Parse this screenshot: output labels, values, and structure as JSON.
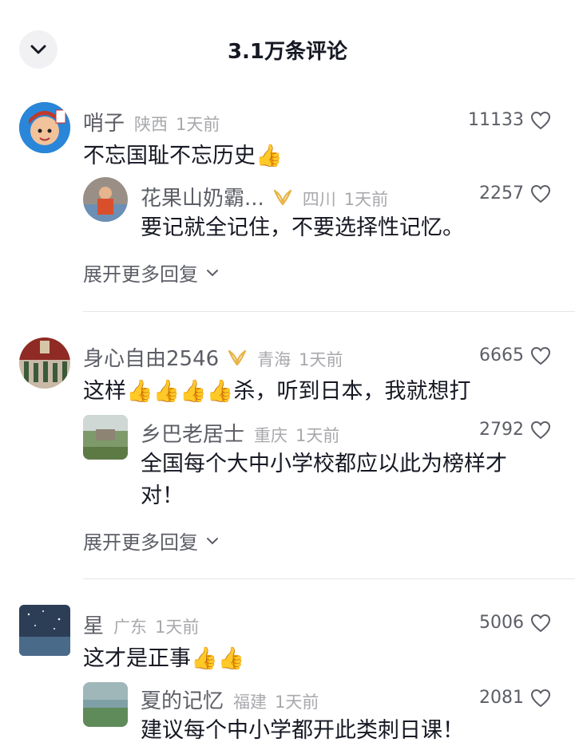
{
  "header": {
    "title": "3.1万条评论"
  },
  "comments": [
    {
      "user": "哨子",
      "region": "陕西",
      "time": "1天前",
      "likes": "11133",
      "text": "不忘国耻不忘历史👍",
      "reply": {
        "user": "花果山奶霸...",
        "region": "四川",
        "time": "1天前",
        "likes": "2257",
        "text": "要记就全记住，不要选择性记忆。"
      },
      "expand": "展开更多回复"
    },
    {
      "user": "身心自由2546",
      "region": "青海",
      "time": "1天前",
      "likes": "6665",
      "text": "这样👍👍👍👍杀，听到日本，我就想打",
      "reply": {
        "user": "乡巴老居士",
        "region": "重庆",
        "time": "1天前",
        "likes": "2792",
        "text_line1": "全国每个大中小学校都应以此为榜样才",
        "text_line2": "对！"
      },
      "expand": "展开更多回复"
    },
    {
      "user": "星",
      "region": "广东",
      "time": "1天前",
      "likes": "5006",
      "text": "这才是正事👍👍",
      "reply": {
        "user": "夏的记忆",
        "region": "福建",
        "time": "1天前",
        "likes": "2081",
        "text": "建议每个中小学都开此类刺日课！"
      }
    }
  ],
  "colors": {
    "accent_badge": "#e8b347",
    "secondary_text": "#5c5e66",
    "meta_text": "#a8a9ad"
  }
}
